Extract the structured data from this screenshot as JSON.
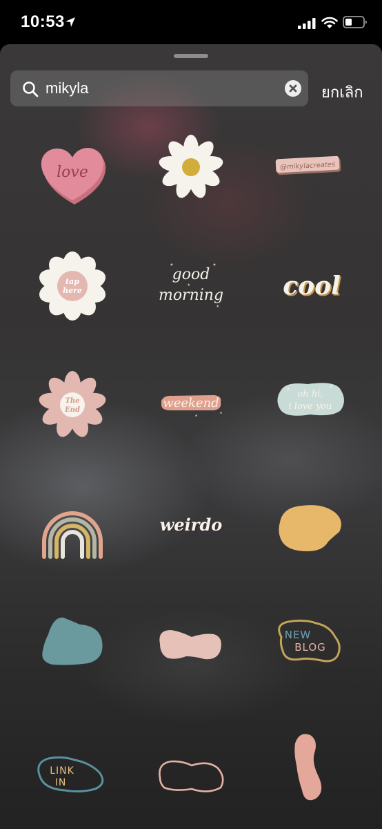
{
  "status_bar": {
    "time": "10:53"
  },
  "search": {
    "query": "mikyla",
    "cancel_label": "ยกเลิก"
  },
  "stickers": {
    "love": "love",
    "mikylacreates": "@mikylacreates",
    "tap_here_line1": "tap",
    "tap_here_line2": "here",
    "good": "good",
    "morning": "morning",
    "cool": "cool",
    "the": "The",
    "end": "End",
    "weekend": "weekend",
    "oh_hi": "oh hi,",
    "i_love_you": "i love you",
    "weirdo": "weirdo",
    "new": "NEW",
    "blog": "BLOG",
    "link": "LINK",
    "in": "IN"
  }
}
